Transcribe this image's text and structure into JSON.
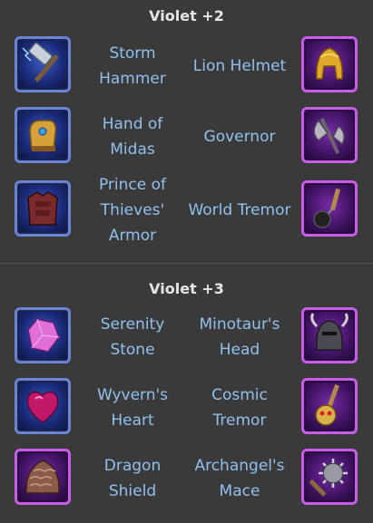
{
  "sections": [
    {
      "title": "Violet +2",
      "rows": [
        {
          "left": {
            "name": "Storm Hammer",
            "lines": [
              "Storm",
              "Hammer"
            ],
            "icon": "storm-hammer-icon"
          },
          "right": {
            "name": "Lion Helmet",
            "lines": [
              "Lion Helmet"
            ],
            "icon": "lion-helmet-icon"
          }
        },
        {
          "left": {
            "name": "Hand of Midas",
            "lines": [
              "Hand of",
              "Midas"
            ],
            "icon": "gauntlet-icon"
          },
          "right": {
            "name": "Governor",
            "lines": [
              "Governor"
            ],
            "icon": "battle-axe-icon"
          }
        },
        {
          "left": {
            "name": "Prince of Thieves' Armor",
            "lines": [
              "Prince of",
              "Thieves'",
              "Armor"
            ],
            "icon": "armor-icon"
          },
          "right": {
            "name": "World Tremor",
            "lines": [
              "World Tremor"
            ],
            "icon": "flail-icon"
          }
        }
      ]
    },
    {
      "title": "Violet +3",
      "rows": [
        {
          "left": {
            "name": "Serenity Stone",
            "lines": [
              "Serenity",
              "Stone"
            ],
            "icon": "gem-icon"
          },
          "right": {
            "name": "Minotaur's Head",
            "lines": [
              "Minotaur's",
              "Head"
            ],
            "icon": "minotaur-helmet-icon"
          }
        },
        {
          "left": {
            "name": "Wyvern's Heart",
            "lines": [
              "Wyvern's",
              "Heart"
            ],
            "icon": "heart-gem-icon"
          },
          "right": {
            "name": "Cosmic Tremor",
            "lines": [
              "Cosmic",
              "Tremor"
            ],
            "icon": "skull-mace-icon"
          }
        },
        {
          "left": {
            "name": "Dragon Shield",
            "lines": [
              "Dragon",
              "Shield"
            ],
            "icon": "scale-shield-icon"
          },
          "right": {
            "name": "Archangel's Mace",
            "lines": [
              "Archangel's",
              "Mace"
            ],
            "icon": "spiked-mace-icon"
          }
        }
      ]
    }
  ],
  "colors": {
    "background": "#3a3a3a",
    "title": "#e6e6e6",
    "label": "#8fc1f0",
    "blue_frame": "#6a84d6",
    "purple_frame": "#c95ce8"
  }
}
